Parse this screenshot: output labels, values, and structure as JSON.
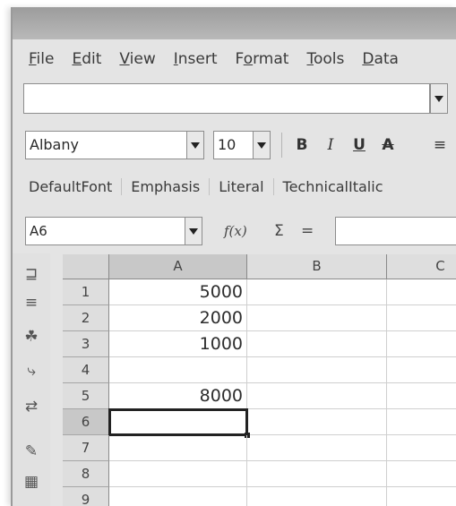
{
  "menu": [
    {
      "text": "File",
      "name": "menu-file"
    },
    {
      "text": "Edit",
      "name": "menu-edit"
    },
    {
      "text": "View",
      "name": "menu-view"
    },
    {
      "text": "Insert",
      "name": "menu-insert"
    },
    {
      "text": "Format",
      "name": "menu-format"
    },
    {
      "text": "Tools",
      "name": "menu-tools"
    },
    {
      "text": "Data",
      "name": "menu-data"
    }
  ],
  "format": {
    "font_name": "Albany",
    "font_size": "10",
    "bold": "B",
    "italic": "I",
    "underline": "U",
    "clear_format": "A",
    "align": "≡"
  },
  "styles": [
    "DefaultFont",
    "Emphasis",
    "Literal",
    "TechnicalItalic"
  ],
  "formula_bar": {
    "name_box": "A6",
    "function_wizard": "f(x)",
    "sum": "Σ",
    "equals": "=",
    "formula": ""
  },
  "sidebar_icons": [
    "insert-cells-icon",
    "insert-rows-icon",
    "navigator-icon",
    "hyperlink-icon",
    "insert-object-icon",
    "draw-icon",
    "chart-icon"
  ],
  "sheet": {
    "columns": [
      "A",
      "B",
      "C"
    ],
    "rows": [
      {
        "num": "1",
        "a": "5000"
      },
      {
        "num": "2",
        "a": "2000"
      },
      {
        "num": "3",
        "a": "1000"
      },
      {
        "num": "4",
        "a": ""
      },
      {
        "num": "5",
        "a": "8000"
      },
      {
        "num": "6",
        "a": ""
      },
      {
        "num": "7",
        "a": ""
      },
      {
        "num": "8",
        "a": ""
      },
      {
        "num": "9",
        "a": ""
      }
    ],
    "active_row": "6",
    "active_col": "A"
  }
}
